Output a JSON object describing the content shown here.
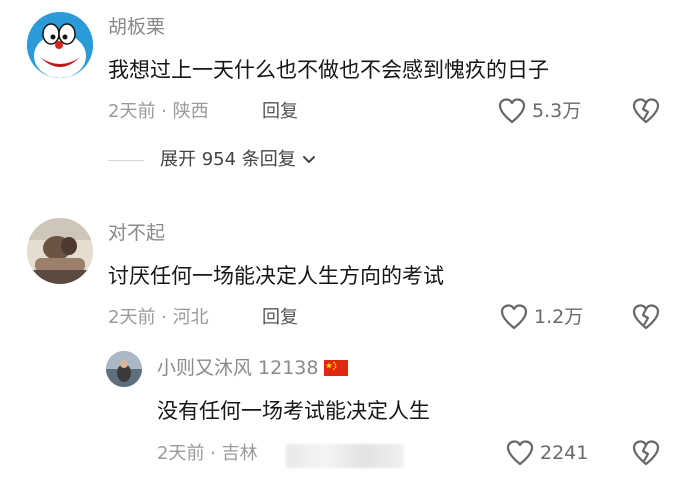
{
  "comments": [
    {
      "username": "胡板栗",
      "content": "我想过上一天什么也不做也不会感到愧疚的日子",
      "time_location": "2天前 · 陕西",
      "reply_label": "回复",
      "likes": "5.3万",
      "expand_label": "展开 954 条回复"
    },
    {
      "username": "对不起",
      "content": "讨厌任何一场能决定人生方向的考试",
      "time_location": "2天前 · 河北",
      "reply_label": "回复",
      "likes": "1.2万",
      "replies": [
        {
          "username": "小则又沐风 12138",
          "content": "没有任何一场考试能决定人生",
          "time_location": "2天前 · 吉林",
          "likes": "2241"
        }
      ]
    }
  ],
  "icons": {
    "like": "heart-outline-icon",
    "dislike": "broken-heart-icon",
    "expand": "chevron-down-icon",
    "flag": "china-flag-icon"
  },
  "colors": {
    "text": "#161616",
    "secondary": "#9a9a9a",
    "flag_red": "#de2910",
    "flag_yellow": "#ffde00"
  }
}
